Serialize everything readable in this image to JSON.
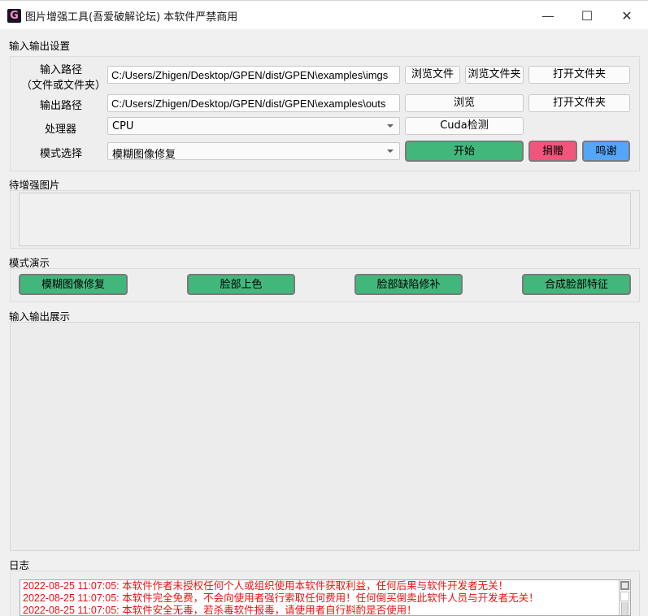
{
  "window": {
    "icon_glyph": "G",
    "title": "图片增强工具(吾爱破解论坛) 本软件严禁商用",
    "minimize": "—",
    "maximize": "☐",
    "close": "✕"
  },
  "io_settings": {
    "section_label": "输入输出设置",
    "input_path": {
      "label_line1": "输入路径",
      "label_line2": "（文件或文件夹）",
      "value": "C:/Users/Zhigen/Desktop/GPEN/dist/GPEN\\examples\\imgs",
      "browse_file": "浏览文件",
      "browse_folder": "浏览文件夹",
      "open_folder": "打开文件夹"
    },
    "output_path": {
      "label": "输出路径",
      "value": "C:/Users/Zhigen/Desktop/GPEN/dist/GPEN\\examples\\outs",
      "browse": "浏览",
      "open_folder": "打开文件夹"
    },
    "processor": {
      "label": "处理器",
      "selected": "CPU",
      "cuda_check": "Cuda检测"
    },
    "mode": {
      "label": "模式选择",
      "selected": "模糊图像修复",
      "start": "开始",
      "donate": "捐赠",
      "thanks": "鸣谢"
    }
  },
  "pending_images": {
    "section_label": "待增强图片"
  },
  "mode_demo": {
    "section_label": "模式演示",
    "buttons": [
      "模糊图像修复",
      "脸部上色",
      "脸部缺陷修补",
      "合成脸部特征"
    ]
  },
  "io_display": {
    "section_label": "输入输出展示"
  },
  "log": {
    "section_label": "日志",
    "lines": [
      "2022-08-25 11:07:05: 本软件作者未授权任何个人或组织使用本软件获取利益，任何后果与软件开发者无关！",
      "2022-08-25 11:07:05: 本软件完全免费，不会向使用者强行索取任何费用！任何倒买倒卖此软件人员与开发者无关！",
      "2022-08-25 11:07:05: 本软件安全无毒，若杀毒软件报毒，请使用者自行斟酌是否使用！"
    ]
  },
  "colors": {
    "start_green": "#42b77c",
    "donate_pink": "#f2557c",
    "thanks_blue": "#55a6f8",
    "log_text_red": "#ee1111"
  }
}
